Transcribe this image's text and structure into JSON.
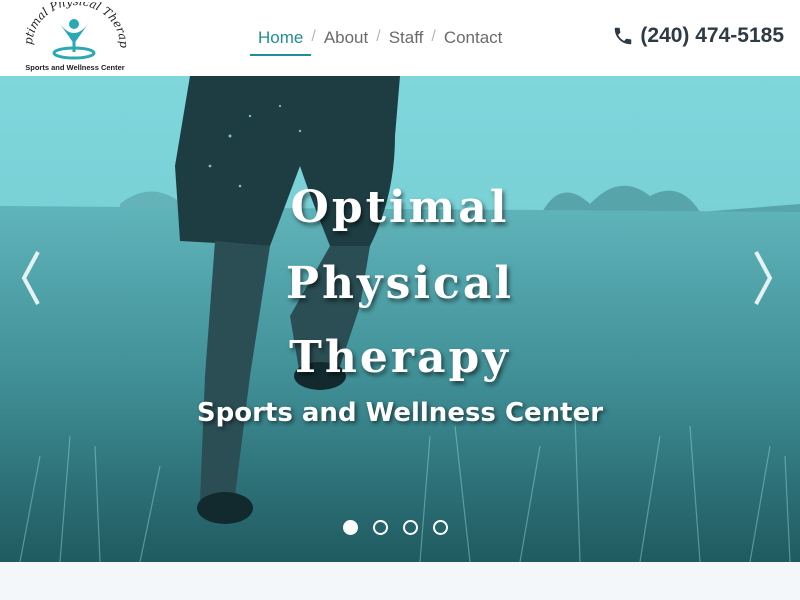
{
  "logo": {
    "arc_text": "Optimal Physical Therapy",
    "tagline": "Sports and Wellness Center"
  },
  "nav": {
    "items": [
      {
        "label": "Home",
        "active": true
      },
      {
        "label": "About",
        "active": false
      },
      {
        "label": "Staff",
        "active": false
      },
      {
        "label": "Contact",
        "active": false
      }
    ],
    "separator": "/"
  },
  "phone": {
    "icon": "phone-icon",
    "number": "(240) 474-5185"
  },
  "hero": {
    "title_lines": [
      "Optimal",
      "Physical",
      "Therapy"
    ],
    "subtitle": "Sports and Wellness Center",
    "prev_icon": "chevron-left-icon",
    "next_icon": "chevron-right-icon",
    "slides_total": 4,
    "active_slide": 1
  },
  "colors": {
    "accent": "#1f8f95",
    "hero_tint": "#6cc9cf",
    "phone_text": "#2e3a44"
  }
}
